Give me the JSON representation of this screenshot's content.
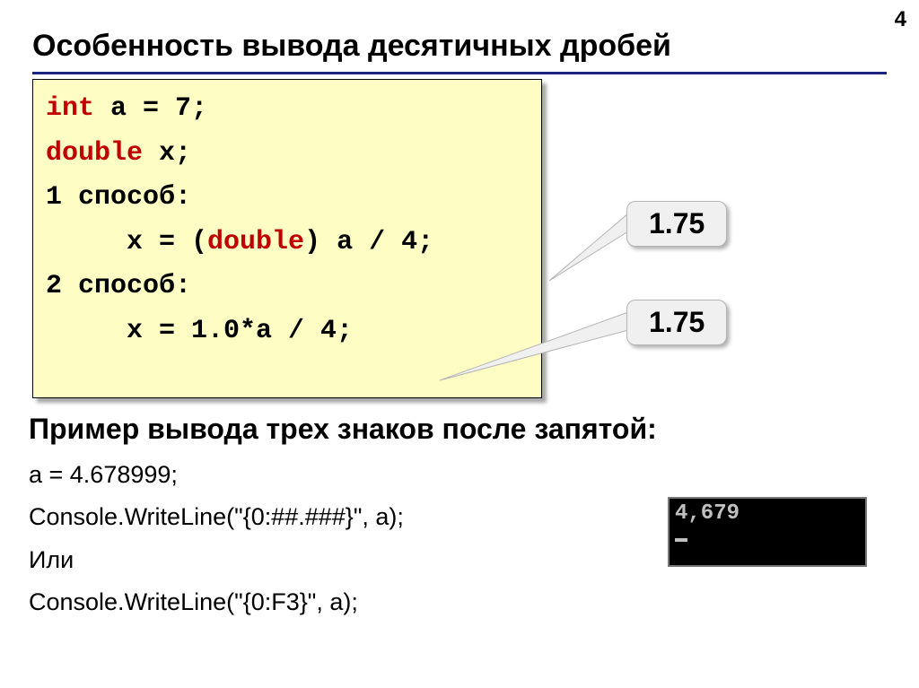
{
  "page_number": "4",
  "title": "Особенность вывода десятичных дробей",
  "code": {
    "line1a": "int",
    "line1b": " a = 7;",
    "line2a": "double",
    "line2b": " x;",
    "line3": "1 способ:",
    "line4a": "     x = (",
    "line4b": "double",
    "line4c": ") a / 4;",
    "line5": "2 способ:",
    "line6": "     x = 1.0*a / 4;"
  },
  "callouts": {
    "c1": "1.75",
    "c2": "1.75"
  },
  "subtitle": "Пример вывода трех знаков после запятой:",
  "example": {
    "l1": "a = 4.678999;",
    "l2": "Console.WriteLine(\"{0:##.###}\", a);",
    "l3": "Или",
    "l4": "Console.WriteLine(\"{0:F3}\", a);"
  },
  "console_output": "4,679"
}
